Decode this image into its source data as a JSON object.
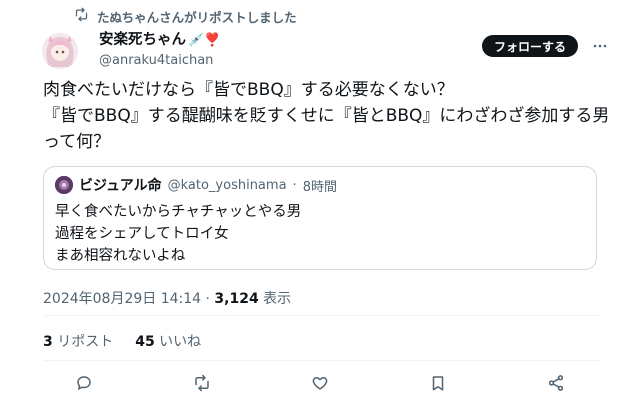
{
  "repost": {
    "text": "たぬちゃんさんがリポストしました"
  },
  "author": {
    "display_name": "安楽死ちゃん",
    "name_emojis": "💉❣️",
    "handle": "@anraku4taichan"
  },
  "follow_label": "フォローする",
  "tweet_text": "肉食べたいだけなら『皆でBBQ』する必要なくない？\n『皆でBBQ』する醍醐味を貶すくせに『皆とBBQ』にわざわざ参加する男って何？",
  "quote": {
    "display_name": "ビジュアル命",
    "handle": "@kato_yoshinama",
    "separator": "·",
    "time": "8時間",
    "text": "早く食べたいからチャチャッとやる男\n過程をシェアしてトロイ女\nまあ相容れないよね"
  },
  "meta": {
    "datetime": "2024年08月29日 14:14",
    "separator": "·",
    "views_count": "3,124",
    "views_label": "表示"
  },
  "stats": {
    "reposts_count": "3",
    "reposts_label": "リポスト",
    "likes_count": "45",
    "likes_label": "いいね"
  },
  "icons": [
    "repost-icon",
    "more-icon",
    "reply-icon",
    "retweet-icon",
    "like-icon",
    "bookmark-icon",
    "share-icon"
  ],
  "colors": {
    "text": "#0f1419",
    "secondary": "#536471",
    "border": "#cfd9de",
    "divider": "#eff3f4",
    "button_bg": "#0f1419",
    "syringe": "#1d9bf0",
    "heart": "#e0245e"
  }
}
